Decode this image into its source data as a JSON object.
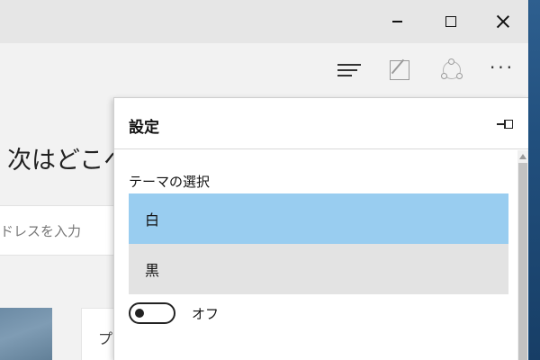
{
  "window": {
    "minimize_icon": "minimize-icon",
    "maximize_icon": "maximize-icon",
    "close_icon": "close-icon"
  },
  "toolbar": {
    "hub_icon": "hub-icon",
    "note_icon": "web-note-icon",
    "share_icon": "share-icon",
    "more_label": "···"
  },
  "page": {
    "heading": "次はどこへ",
    "address_placeholder": "ドレスを入力",
    "card_letter": "プ"
  },
  "settings": {
    "title": "設定",
    "pin_icon": "pin-icon",
    "theme_label": "テーマの選択",
    "theme_options": [
      {
        "label": "白",
        "selected": true
      },
      {
        "label": "黒",
        "selected": false
      }
    ],
    "toggle_label": "オフ",
    "toggle_on": false
  },
  "colors": {
    "selected_option": "#99cdf0",
    "unselected_option": "#e3e3e3",
    "titlebar": "#e6e6e6"
  }
}
